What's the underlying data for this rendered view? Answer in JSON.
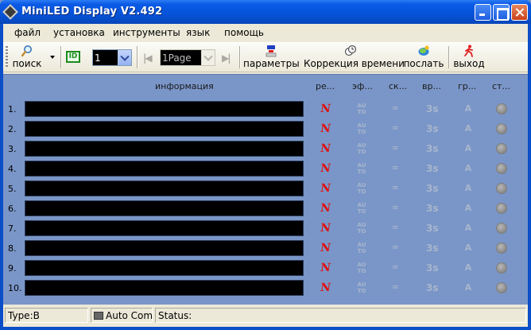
{
  "window": {
    "title": "MiniLED Display V2.492"
  },
  "menu": [
    "файл",
    "установка",
    "инструменты",
    "язык",
    "помощь"
  ],
  "toolbar": {
    "search_label": "поиск",
    "id_badge": "ID",
    "id_value": "1",
    "page_value": "1Page",
    "prev_page": "|◀",
    "next_page": "▶|",
    "params_label": "параметры",
    "time_correction_label": "Коррекция времени",
    "send_label": "послать",
    "exit_label": "выход"
  },
  "columns": {
    "info": "информация",
    "c1": "ре...",
    "c2": "эф...",
    "c3": "ск...",
    "c4": "вр...",
    "c5": "гр...",
    "c6": "ст..."
  },
  "rows": [
    {
      "num": "1."
    },
    {
      "num": "2."
    },
    {
      "num": "3."
    },
    {
      "num": "4."
    },
    {
      "num": "5."
    },
    {
      "num": "6."
    },
    {
      "num": "7."
    },
    {
      "num": "8."
    },
    {
      "num": "9."
    },
    {
      "num": "10."
    }
  ],
  "row_icons": {
    "mode": "N",
    "effect": "AU TO",
    "speed": "=",
    "time": "3s",
    "font": "A"
  },
  "status": {
    "type": "Type:B",
    "com": "Auto Com",
    "status": "Status:"
  },
  "colors": {
    "titlebar": "#0553d8",
    "panel": "#7a96c8",
    "mode_icon": "#e01010",
    "bar": "#000000"
  }
}
